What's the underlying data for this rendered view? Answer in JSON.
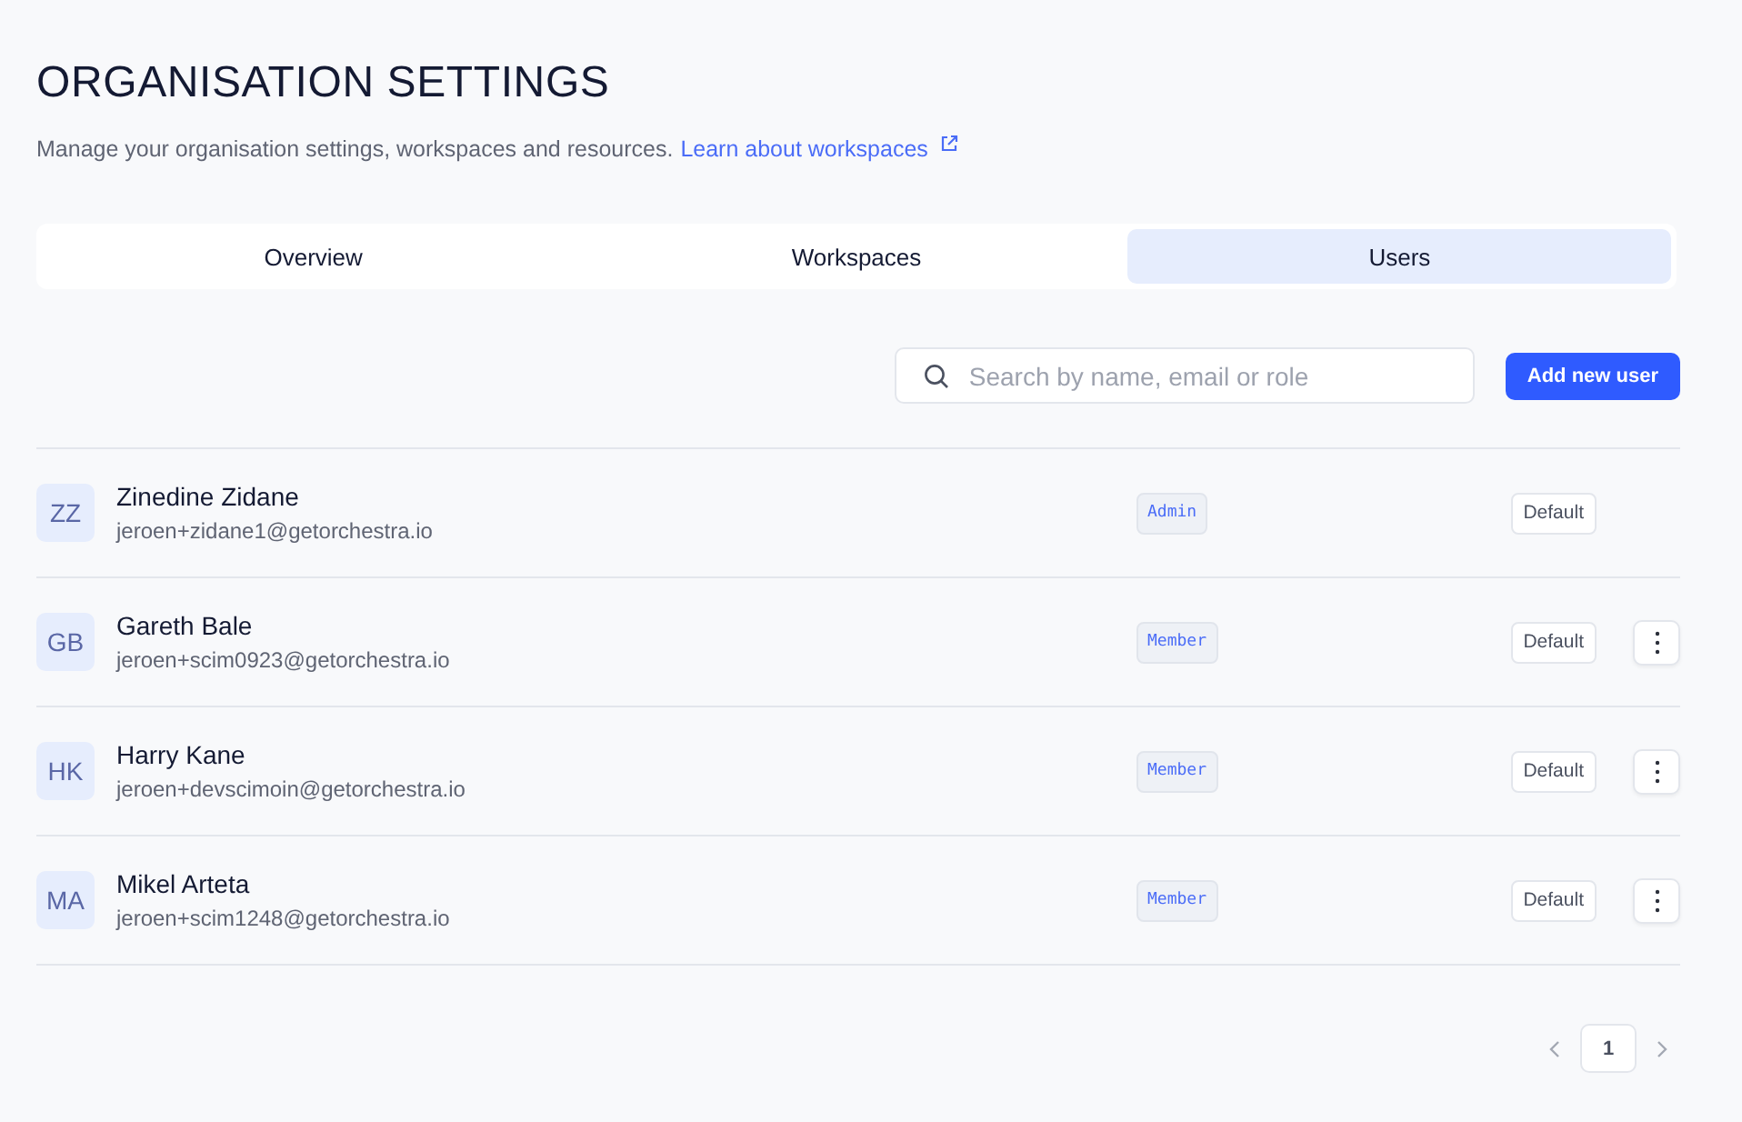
{
  "header": {
    "title": "ORGANISATION SETTINGS",
    "description": "Manage your organisation settings, workspaces and resources.",
    "link": "Learn about workspaces"
  },
  "tabs": [
    {
      "label": "Overview",
      "selected": false
    },
    {
      "label": "Workspaces",
      "selected": false
    },
    {
      "label": "Users",
      "selected": true
    }
  ],
  "search": {
    "placeholder": "Search by name, email or role"
  },
  "add_button": "Add new user",
  "users": [
    {
      "initials": "ZZ",
      "name": "Zinedine Zidane",
      "email": "jeroen+zidane1@getorchestra.io",
      "role": "Admin",
      "workspace_role": "Default",
      "has_menu": false
    },
    {
      "initials": "GB",
      "name": "Gareth Bale",
      "email": "jeroen+scim0923@getorchestra.io",
      "role": "Member",
      "workspace_role": "Default",
      "has_menu": true
    },
    {
      "initials": "HK",
      "name": "Harry Kane",
      "email": "jeroen+devscimoin@getorchestra.io",
      "role": "Member",
      "workspace_role": "Default",
      "has_menu": true
    },
    {
      "initials": "MA",
      "name": "Mikel Arteta",
      "email": "jeroen+scim1248@getorchestra.io",
      "role": "Member",
      "workspace_role": "Default",
      "has_menu": true
    }
  ],
  "pagination": {
    "pages": [
      {
        "label": "1",
        "selected": true
      }
    ]
  }
}
